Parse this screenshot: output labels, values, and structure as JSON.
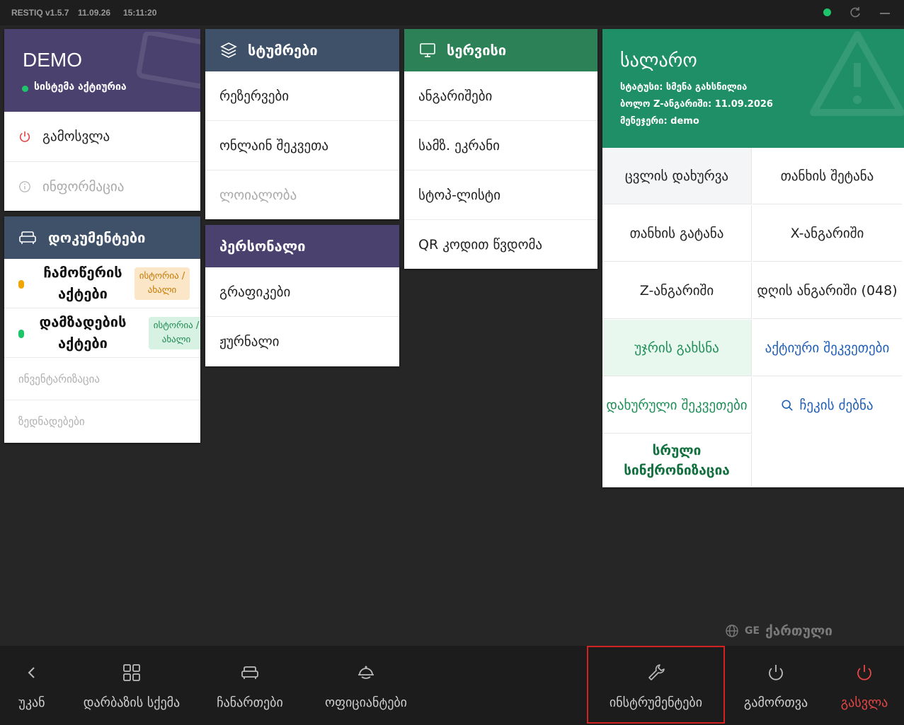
{
  "topbar": {
    "version": "RESTIQ v1.5.7",
    "date": "11.09.26",
    "time": "15:11:20",
    "status_color": "#1ec46a"
  },
  "demo": {
    "title": "DEMO",
    "status": "სისტემა აქტიურია",
    "items": [
      {
        "label": "გამოსვლა",
        "icon": "power-icon"
      },
      {
        "label": "ინფორმაცია",
        "icon": "info-icon"
      }
    ]
  },
  "guests": {
    "title": "სტუმრები",
    "items": [
      "რეზერვები",
      "ონლაინ შეკვეთა",
      "ლოიალობა"
    ]
  },
  "service": {
    "title": "სერვისი",
    "items": [
      "ანგარიშები",
      "სამზ. ეკრანი",
      "სტოპ-ლისტი",
      "QR კოდით წვდომა"
    ]
  },
  "documents": {
    "title": "დოკუმენტები",
    "rows": [
      {
        "label": "ჩამოწერის აქტები",
        "badge": "ისტორია / ახალი",
        "color": "#f0a500"
      },
      {
        "label": "დამზადების აქტები",
        "badge": "ისტორია / ახალი",
        "color": "#1ec46a"
      }
    ],
    "items": [
      "ინვენტარიზაცია",
      "ზედნადებები"
    ]
  },
  "personnel": {
    "title": "პერსონალი",
    "items": [
      "გრაფიკები",
      "ჟურნალი"
    ]
  },
  "cash": {
    "title": "სალარო",
    "status": "სტატუსი: სმენა გახსნილია",
    "last_z": "ბოლო Z-ანგარიში: 11.09.2026",
    "manager": "მენეჯერი: demo",
    "cells": {
      "close_shift": "ცვლის დახურვა",
      "cash_in": "თანხის შეტანა",
      "cash_out": "თანხის გატანა",
      "x_report": "X-ანგარიში",
      "z_report": "Z-ანგარიში",
      "day_report": "დღის ანგარიში (048)",
      "open_drawer": "უჯრის გახსნა",
      "active_orders": "აქტიური შეკვეთები",
      "closed_orders": "დახურული შეკვეთები",
      "check_search": "ჩეკის ძებნა",
      "full_sync": "სრული სინქრონიზაცია"
    }
  },
  "language": {
    "code": "GE",
    "name": "ქართული"
  },
  "bottom": [
    {
      "label": "უკან",
      "icon": "back-icon"
    },
    {
      "label": "დარბაზის სქემა",
      "icon": "grid-icon"
    },
    {
      "label": "ჩანართები",
      "icon": "sofa-icon"
    },
    {
      "label": "ოფიციანტები",
      "icon": "waiter-icon"
    },
    {
      "label": "ინსტრუმენტები",
      "icon": "wrench-icon"
    },
    {
      "label": "გამორთვა",
      "icon": "power-icon"
    },
    {
      "label": "გასვლა",
      "icon": "exit-power-icon"
    }
  ]
}
